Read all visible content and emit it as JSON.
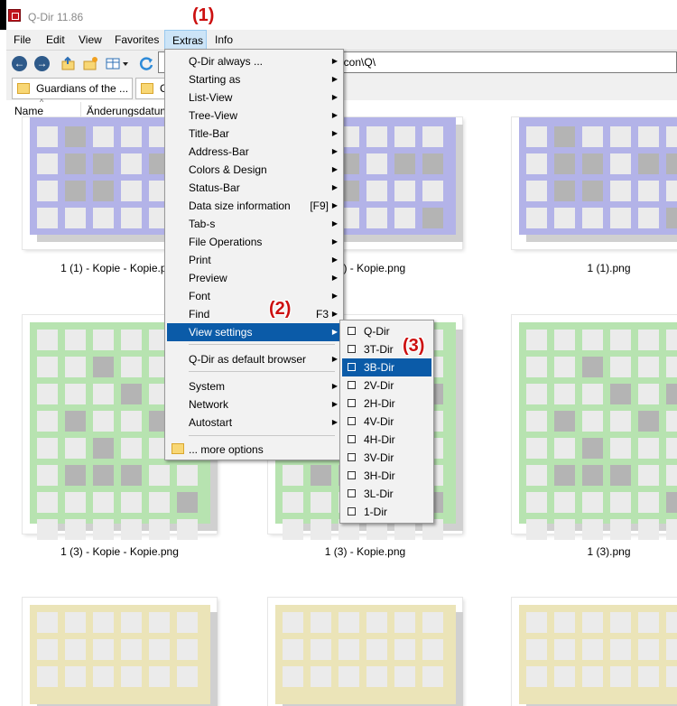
{
  "window": {
    "title": "Q-Dir 11.86"
  },
  "menubar": {
    "items": [
      "File",
      "Edit",
      "View",
      "Favorites",
      "Extras",
      "Info"
    ]
  },
  "address": {
    "value": "g\\icon\\Q\\"
  },
  "tabs": [
    {
      "label": "Guardians of the ..."
    },
    {
      "label": "C"
    }
  ],
  "columns": {
    "name": "Name",
    "date": "Änderungsdatum"
  },
  "files": [
    {
      "caption": "1 (1) - Kopie - Kopie.png",
      "shown": "1 (1) - Kopie - Kopie.png"
    },
    {
      "caption": "1 (1) - Kopie.png"
    },
    {
      "caption": "1 (1).png"
    },
    {
      "caption": "1 (3) - Kopie - Kopie.png"
    },
    {
      "caption": "1 (3) - Kopie.png"
    },
    {
      "caption": "1 (3).png"
    }
  ],
  "extras_menu": {
    "items": [
      {
        "label": "Q-Dir always ...",
        "submenu": true
      },
      {
        "label": "Starting as",
        "submenu": true
      },
      {
        "label": "List-View",
        "submenu": true
      },
      {
        "label": "Tree-View",
        "submenu": true
      },
      {
        "label": "Title-Bar",
        "submenu": true
      },
      {
        "label": "Address-Bar",
        "submenu": true
      },
      {
        "label": "Colors & Design",
        "submenu": true
      },
      {
        "label": "Status-Bar",
        "submenu": true
      },
      {
        "label": "Data size information",
        "shortcut": "[F9]",
        "submenu": true
      },
      {
        "label": "Tab-s",
        "submenu": true
      },
      {
        "label": "File Operations",
        "submenu": true
      },
      {
        "label": "Print",
        "submenu": true
      },
      {
        "label": "Preview",
        "submenu": true
      },
      {
        "label": "Font",
        "submenu": true
      },
      {
        "label": "Find",
        "shortcut": "F3",
        "submenu": true
      },
      {
        "label": "View settings",
        "submenu": true,
        "highlighted": true
      },
      {
        "label": "Q-Dir as default browser",
        "submenu": true
      },
      {
        "label": "System",
        "submenu": true
      },
      {
        "label": "Network",
        "submenu": true
      },
      {
        "label": "Autostart",
        "submenu": true
      },
      {
        "label": "... more options",
        "submenu": false
      }
    ]
  },
  "view_submenu": {
    "items": [
      {
        "label": "Q-Dir"
      },
      {
        "label": "3T-Dir"
      },
      {
        "label": "3B-Dir",
        "highlighted": true
      },
      {
        "label": "2V-Dir"
      },
      {
        "label": "2H-Dir"
      },
      {
        "label": "4V-Dir"
      },
      {
        "label": "4H-Dir"
      },
      {
        "label": "3V-Dir"
      },
      {
        "label": "3H-Dir"
      },
      {
        "label": "3L-Dir"
      },
      {
        "label": "1-Dir"
      }
    ]
  },
  "annotations": [
    "(1)",
    "(2)",
    "(3)"
  ],
  "colors": {
    "purple": "#b3b3e8",
    "green": "#b7e3b0",
    "yellow": "#ebe4b8",
    "cell_light": "#ebebeb",
    "cell_dark": "#b4b4b4",
    "highlight": "#0b5ba8"
  }
}
